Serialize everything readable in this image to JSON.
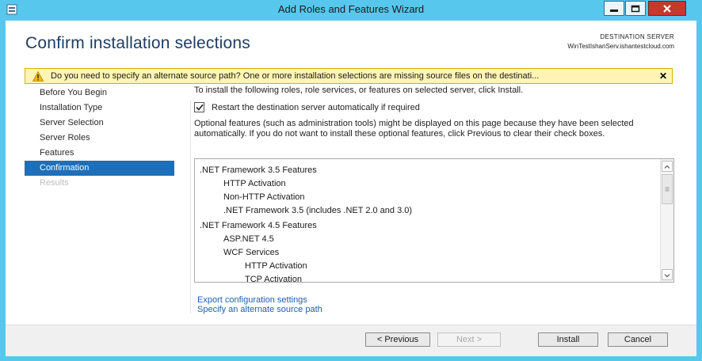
{
  "window": {
    "title": "Add Roles and Features Wizard",
    "icon": "server-manager-icon",
    "colors": {
      "frame": "#58c7ee",
      "close": "#c7372c",
      "accent": "#1e6fb8",
      "link": "#1e5fb0",
      "warning_bg": "#fff4b3"
    }
  },
  "header": {
    "title": "Confirm installation selections",
    "destination_label": "DESTINATION SERVER",
    "destination_value": "WinTestIshanServ.ishantestcloud.com"
  },
  "warning": {
    "icon": "warning-icon",
    "text": "Do you need to specify an alternate source path? One or more installation selections are missing source files on the destinati...",
    "close": "✕"
  },
  "nav": {
    "items": [
      {
        "label": "Before You Begin",
        "state": "normal"
      },
      {
        "label": "Installation Type",
        "state": "normal"
      },
      {
        "label": "Server Selection",
        "state": "normal"
      },
      {
        "label": "Server Roles",
        "state": "normal"
      },
      {
        "label": "Features",
        "state": "normal"
      },
      {
        "label": "Confirmation",
        "state": "active"
      },
      {
        "label": "Results",
        "state": "disabled"
      }
    ]
  },
  "content": {
    "intro": "To install the following roles, role services, or features on selected server, click Install.",
    "restart_checkbox": {
      "label": "Restart the destination server automatically if required",
      "checked": true
    },
    "optional_text": "Optional features (such as administration tools) might be displayed on this page because they have been selected automatically. If you do not want to install these optional features, click Previous to clear their check boxes.",
    "features": [
      {
        "label": ".NET Framework 3.5 Features",
        "level": 0
      },
      {
        "label": "HTTP Activation",
        "level": 1
      },
      {
        "label": "Non-HTTP Activation",
        "level": 1
      },
      {
        "label": ".NET Framework 3.5 (includes .NET 2.0 and 3.0)",
        "level": 1
      },
      {
        "label": ".NET Framework 4.5 Features",
        "level": 0
      },
      {
        "label": "ASP.NET 4.5",
        "level": 1
      },
      {
        "label": "WCF Services",
        "level": 1
      },
      {
        "label": "HTTP Activation",
        "level": 2
      },
      {
        "label": "TCP Activation",
        "level": 2
      }
    ],
    "links": {
      "export": "Export configuration settings",
      "alternate_source": "Specify an alternate source path"
    }
  },
  "footer": {
    "previous": "< Previous",
    "next": "Next >",
    "install": "Install",
    "cancel": "Cancel"
  }
}
